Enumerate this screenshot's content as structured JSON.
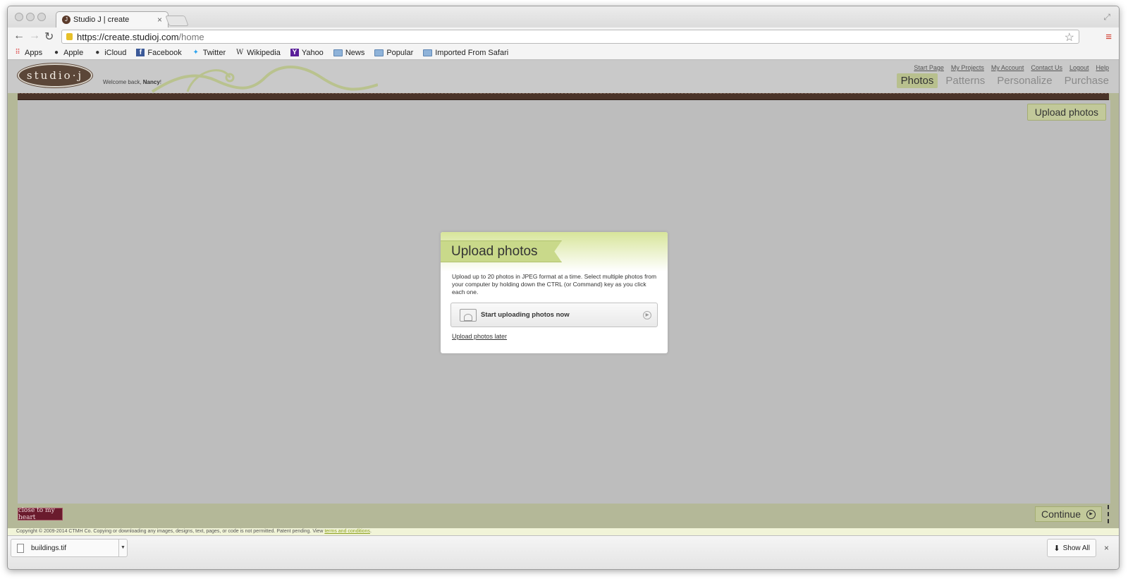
{
  "browser": {
    "tab_title": "Studio J | create",
    "tab_favicon": "J",
    "url_protocol": "https://",
    "url_host": "create.studioj.com",
    "url_path": "/home",
    "bookmarks": [
      {
        "label": "Apps",
        "icon": "apps-grid-icon"
      },
      {
        "label": "Apple",
        "icon": "apple-icon"
      },
      {
        "label": "iCloud",
        "icon": "apple-icon"
      },
      {
        "label": "Facebook",
        "icon": "facebook-icon"
      },
      {
        "label": "Twitter",
        "icon": "twitter-icon"
      },
      {
        "label": "Wikipedia",
        "icon": "wikipedia-icon"
      },
      {
        "label": "Yahoo",
        "icon": "yahoo-icon"
      },
      {
        "label": "News",
        "icon": "folder-icon"
      },
      {
        "label": "Popular",
        "icon": "folder-icon"
      },
      {
        "label": "Imported From Safari",
        "icon": "folder-icon"
      }
    ]
  },
  "site": {
    "logo_text": "studio·j",
    "welcome_prefix": "Welcome back, ",
    "welcome_name": "Nancy",
    "welcome_suffix": "!",
    "top_links": [
      "Start Page",
      "My Projects",
      "My Account",
      "Contact Us",
      "Logout",
      "Help"
    ],
    "nav": [
      {
        "label": "Photos",
        "active": true
      },
      {
        "label": "Patterns",
        "active": false
      },
      {
        "label": "Personalize",
        "active": false
      },
      {
        "label": "Purchase",
        "active": false
      }
    ],
    "upload_button": "Upload photos",
    "continue_button": "Continue",
    "footer_logo": "close to my heart",
    "copyright": "Copyright © 2009-2014 CTMH Co. Copying or downloading any images, designs, text, pages, or code is not permitted. Patent pending. View ",
    "terms_link": "terms and conditions",
    "copyright_end": "."
  },
  "modal": {
    "title": "Upload photos",
    "description": "Upload up to 20 photos in JPEG format at a time. Select multiple photos from your computer by holding down the CTRL (or Command) key as you click each one.",
    "start_button": "Start uploading photos now",
    "later_link": "Upload photos later"
  },
  "downloads": {
    "file_name": "buildings.tif",
    "show_all": "Show All"
  },
  "colors": {
    "accent_green": "#c2c99a",
    "frame_green": "#b4b898",
    "stitch_brown": "#4a3328"
  }
}
